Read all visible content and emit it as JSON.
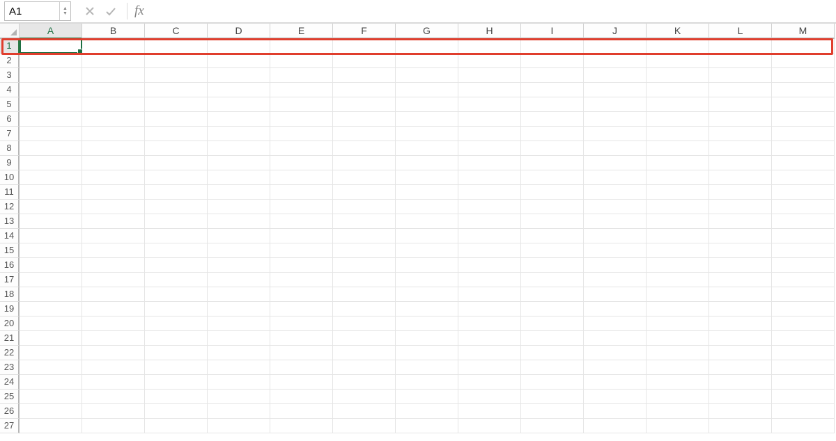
{
  "formula_bar": {
    "name_box_value": "A1",
    "fx_label": "fx",
    "formula_value": ""
  },
  "columns": [
    "A",
    "B",
    "C",
    "D",
    "E",
    "F",
    "G",
    "H",
    "I",
    "J",
    "K",
    "L",
    "M"
  ],
  "rows": [
    "1",
    "2",
    "3",
    "4",
    "5",
    "6",
    "7",
    "8",
    "9",
    "10",
    "11",
    "12",
    "13",
    "14",
    "15",
    "16",
    "17",
    "18",
    "19",
    "20",
    "21",
    "22",
    "23",
    "24",
    "25",
    "26",
    "27"
  ],
  "active_cell": "A1",
  "active_column": "A",
  "active_row": "1"
}
